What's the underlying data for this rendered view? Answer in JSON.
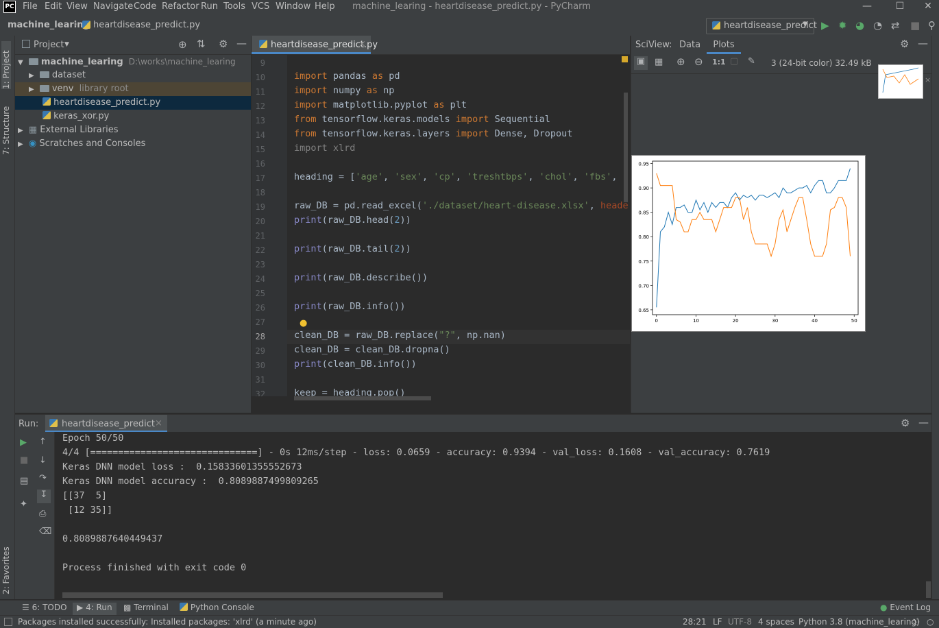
{
  "app": {
    "logo_text": "PC",
    "menus": [
      "File",
      "Edit",
      "View",
      "Navigate",
      "Code",
      "Refactor",
      "Run",
      "Tools",
      "VCS",
      "Window",
      "Help"
    ],
    "window_title": "machine_learing - heartdisease_predict.py - PyCharm"
  },
  "navbar": {
    "project": "machine_learing",
    "file": "heartdisease_predict.py",
    "run_config": "heartdisease_predict"
  },
  "left_strip": {
    "project_tab": "1: Project",
    "structure_tab": "7: Structure",
    "favorites_tab": "2: Favorites"
  },
  "project_panel": {
    "title": "Project",
    "root_name": "machine_learing",
    "root_path": "D:\\works\\machine_learing",
    "items": [
      {
        "label": "dataset"
      },
      {
        "label": "venv",
        "suffix": "library root"
      },
      {
        "label": "heartdisease_predict.py"
      },
      {
        "label": "keras_xor.py"
      },
      {
        "label": "External Libraries"
      },
      {
        "label": "Scratches and Consoles"
      }
    ]
  },
  "editor": {
    "tab_label": "heartdisease_predict.py",
    "line_numbers": [
      "9",
      "10",
      "11",
      "12",
      "13",
      "14",
      "15",
      "16",
      "17",
      "18",
      "19",
      "20",
      "21",
      "22",
      "23",
      "24",
      "25",
      "26",
      "27",
      "28",
      "29",
      "30",
      "31",
      "32"
    ]
  },
  "sciview": {
    "title": "SciView:",
    "tabs": [
      "Data",
      "Plots"
    ],
    "image_info": "3 (24-bit color) 32.49 kB",
    "actual_size_label": "1:1"
  },
  "chart_data": {
    "type": "line",
    "x": [
      0,
      1,
      2,
      3,
      4,
      5,
      6,
      7,
      8,
      9,
      10,
      11,
      12,
      13,
      14,
      15,
      16,
      17,
      18,
      19,
      20,
      21,
      22,
      23,
      24,
      25,
      26,
      27,
      28,
      29,
      30,
      31,
      32,
      33,
      34,
      35,
      36,
      37,
      38,
      39,
      40,
      41,
      42,
      43,
      44,
      45,
      46,
      47,
      48,
      49
    ],
    "xticks": [
      0,
      10,
      20,
      30,
      40,
      50
    ],
    "yticks": [
      "0.65",
      "0.70",
      "0.75",
      "0.80",
      "0.85",
      "0.90",
      "0.95"
    ],
    "xlim": [
      -1,
      51
    ],
    "ylim": [
      0.64,
      0.955
    ],
    "series": [
      {
        "color": "#1f77b4",
        "values": [
          0.655,
          0.81,
          0.82,
          0.85,
          0.825,
          0.86,
          0.86,
          0.865,
          0.85,
          0.85,
          0.875,
          0.855,
          0.87,
          0.85,
          0.87,
          0.86,
          0.87,
          0.87,
          0.86,
          0.88,
          0.89,
          0.875,
          0.885,
          0.88,
          0.885,
          0.875,
          0.885,
          0.885,
          0.88,
          0.885,
          0.89,
          0.88,
          0.9,
          0.89,
          0.89,
          0.895,
          0.9,
          0.9,
          0.905,
          0.89,
          0.905,
          0.915,
          0.915,
          0.89,
          0.89,
          0.9,
          0.915,
          0.915,
          0.915,
          0.94
        ]
      },
      {
        "color": "#ff7f0e",
        "values": [
          0.93,
          0.905,
          0.905,
          0.905,
          0.905,
          0.835,
          0.83,
          0.81,
          0.81,
          0.835,
          0.835,
          0.85,
          0.835,
          0.835,
          0.835,
          0.81,
          0.835,
          0.86,
          0.86,
          0.86,
          0.88,
          0.88,
          0.835,
          0.86,
          0.81,
          0.785,
          0.785,
          0.785,
          0.785,
          0.76,
          0.785,
          0.835,
          0.855,
          0.81,
          0.835,
          0.86,
          0.88,
          0.88,
          0.835,
          0.785,
          0.76,
          0.76,
          0.76,
          0.785,
          0.855,
          0.86,
          0.88,
          0.88,
          0.86,
          0.76
        ]
      }
    ]
  },
  "run_panel": {
    "label": "Run:",
    "tab": "heartdisease_predict",
    "output": [
      "Epoch 50/50",
      "4/4 [==============================] - 0s 12ms/step - loss: 0.0659 - accuracy: 0.9394 - val_loss: 0.1608 - val_accuracy: 0.7619",
      "Keras DNN model loss :  0.15833601355552673",
      "Keras DNN model accuracy :  0.8089887499809265",
      "[[37  5]",
      " [12 35]]",
      "",
      "0.8089887640449437",
      "",
      "Process finished with exit code 0"
    ]
  },
  "toolwindows": {
    "todo": "6: TODO",
    "run": "4: Run",
    "terminal": "Terminal",
    "python_console": "Python Console",
    "event_log": "Event Log"
  },
  "status": {
    "message": "Packages installed successfully: Installed packages: 'xlrd' (a minute ago)",
    "position": "28:21",
    "line_sep": "LF",
    "encoding": "UTF-8",
    "indent": "4 spaces",
    "interpreter": "Python 3.8 (machine_learing)"
  }
}
